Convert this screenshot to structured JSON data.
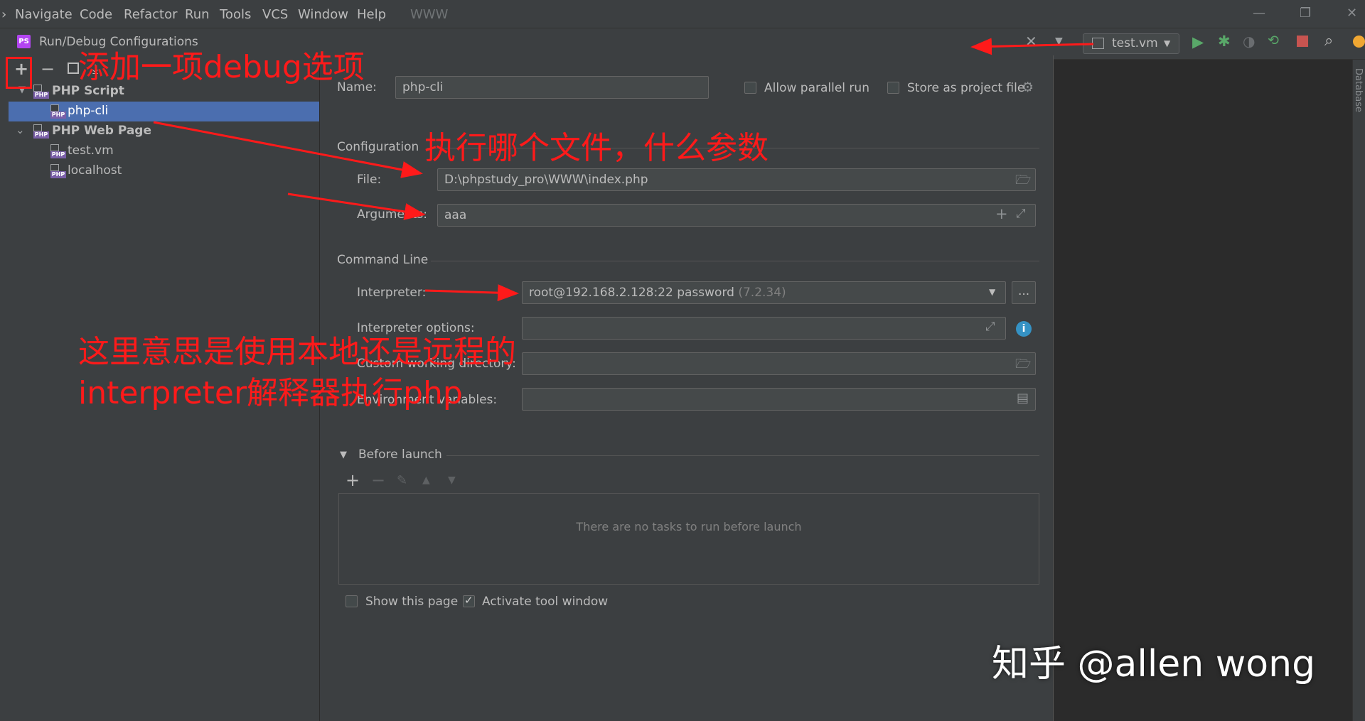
{
  "menu": {
    "items": [
      "Navigate",
      "Code",
      "Refactor",
      "Run",
      "Tools",
      "VCS",
      "Window",
      "Help"
    ],
    "project": "WWW"
  },
  "dialog": {
    "title": "Run/Debug Configurations",
    "tree": [
      {
        "label": "PHP Script",
        "type": "group"
      },
      {
        "label": "php-cli",
        "type": "item",
        "selected": true
      },
      {
        "label": "PHP Web Page",
        "type": "group"
      },
      {
        "label": "test.vm",
        "type": "item"
      },
      {
        "label": "localhost",
        "type": "item"
      }
    ],
    "name_label": "Name:",
    "name_value": "php-cli",
    "allow_parallel": "Allow parallel run",
    "store_project": "Store as project file",
    "configuration": "Configuration",
    "file_label": "File:",
    "file_value": "D:\\phpstudy_pro\\WWW\\index.php",
    "arguments_label": "Arguments:",
    "arguments_value": "aaa",
    "command_line": "Command Line",
    "interpreter_label": "Interpreter:",
    "interpreter_value": "root@192.168.2.128:22 password",
    "interpreter_version": "(7.2.34)",
    "interp_options_label": "Interpreter options:",
    "working_dir_label": "Custom working directory:",
    "env_label": "Environment variables:",
    "before_launch": "Before launch",
    "no_tasks": "There are no tasks to run before launch",
    "show_page": "Show this page",
    "activate_tool": "Activate tool window",
    "more_button": "..."
  },
  "toolbar": {
    "run_config": "test.vm"
  },
  "side_tab": "Database",
  "annotations": {
    "add_option": "添加一项debug选项",
    "which_file": "执行哪个文件，什么参数",
    "local_remote_1": "这里意思是使用本地还是远程的",
    "local_remote_2": "interpreter解释器执行php"
  },
  "watermark": "知乎 @allen wong",
  "colors": {
    "selection": "#4b6eaf",
    "annotation": "#ff1a1a",
    "run_green": "#59a869"
  }
}
